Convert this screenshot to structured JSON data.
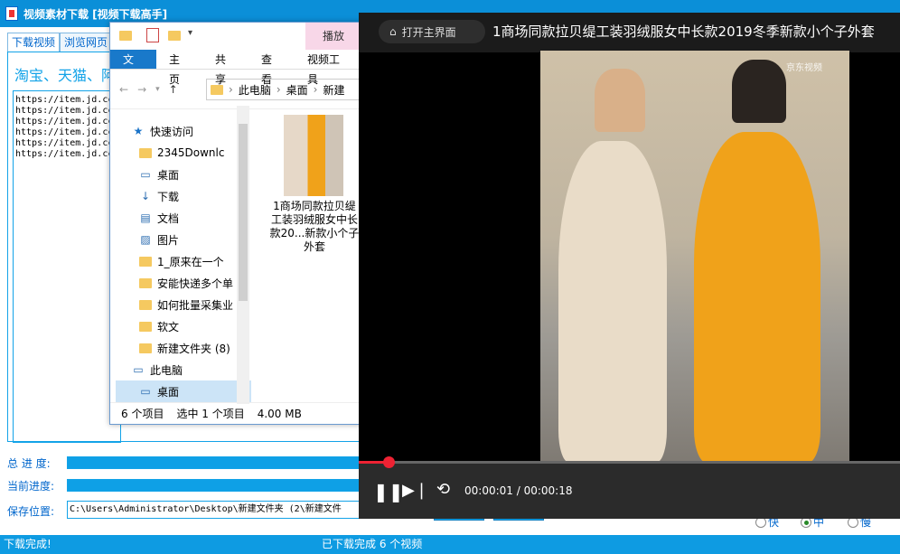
{
  "app": {
    "title": "视频素材下载 [视频下载高手]",
    "tabs": [
      "下载视频",
      "浏览网页"
    ],
    "slogan": "淘宝、天猫、阿",
    "urls": [
      "https://item.jd.cc",
      "https://item.jd.cc",
      "https://item.jd.cc",
      "https://item.jd.cc",
      "https://item.jd.cc",
      "https://item.jd.cc"
    ],
    "total_progress_label": "总 进 度:",
    "current_progress_label": "当前进度:",
    "save_location_label": "保存位置:",
    "save_path": "C:\\Users\\Administrator\\Desktop\\新建文件夹 (2\\新建文件",
    "speed_options": [
      "快",
      "中",
      "慢"
    ],
    "speed_selected": "中",
    "status_left": "下载完成!",
    "status_right": "已下载完成 6 个视频"
  },
  "explorer": {
    "play_tab": "播放",
    "ribbon_tabs": [
      "文件",
      "主页",
      "共享",
      "查看",
      "视频工具"
    ],
    "address": [
      "此电脑",
      "桌面",
      "新建"
    ],
    "nav": [
      {
        "label": "快速访问",
        "icon": "star-icon",
        "pinned": false
      },
      {
        "label": "2345Downlc",
        "icon": "folder-icon",
        "pinned": true
      },
      {
        "label": "桌面",
        "icon": "desktop-icon",
        "pinned": true
      },
      {
        "label": "下载",
        "icon": "download-icon",
        "pinned": true
      },
      {
        "label": "文档",
        "icon": "document-icon",
        "pinned": true
      },
      {
        "label": "图片",
        "icon": "picture-icon",
        "pinned": true
      },
      {
        "label": "1_原来在一个",
        "icon": "folder-icon",
        "pinned": true
      },
      {
        "label": "安能快递多个单",
        "icon": "folder-icon",
        "pinned": false
      },
      {
        "label": "如何批量采集业",
        "icon": "folder-icon",
        "pinned": false
      },
      {
        "label": "软文",
        "icon": "folder-icon",
        "pinned": false
      },
      {
        "label": "新建文件夹 (8)",
        "icon": "folder-icon",
        "pinned": false
      },
      {
        "label": "此电脑",
        "icon": "computer-icon",
        "pinned": false
      },
      {
        "label": "桌面",
        "icon": "desktop-icon",
        "pinned": false
      }
    ],
    "file_name": "1商场同款拉贝缇工装羽绒服女中长款20...新款小个子外套",
    "status": [
      "6 个项目",
      "选中 1 个项目",
      "4.00 MB"
    ]
  },
  "player": {
    "home_button": "打开主界面",
    "title": "1商场同款拉贝缇工装羽绒服女中长款2019冬季新款小个子外套",
    "watermark": "京东视频",
    "time": "00:00:01 / 00:00:18",
    "progress": 0.055
  }
}
